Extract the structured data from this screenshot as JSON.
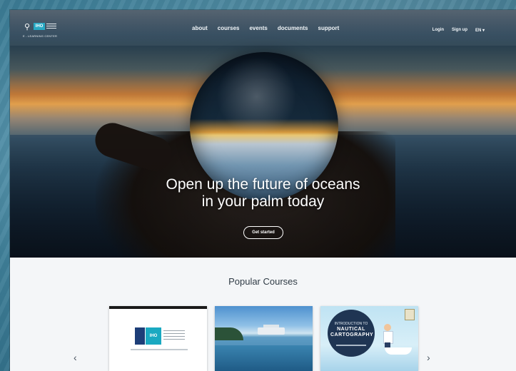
{
  "nav": {
    "logo_badge": "IHO",
    "logo_caption": "E - LEARNING CENTER",
    "links": [
      "about",
      "courses",
      "events",
      "documents",
      "support"
    ],
    "login": "Login",
    "signup": "Sign up",
    "language": "EN ▾"
  },
  "hero": {
    "headline_line1": "Open up the future of oceans",
    "headline_line2": "in your palm today",
    "cta": "Get started"
  },
  "popular": {
    "title": "Popular Courses",
    "card1_badge": "IHO",
    "card3_line1": "INTRODUCTION TO",
    "card3_line2": "NAUTICAL",
    "card3_line3": "CARTOGRAPHY",
    "prev_icon": "chevron-left-icon",
    "next_icon": "chevron-right-icon"
  }
}
